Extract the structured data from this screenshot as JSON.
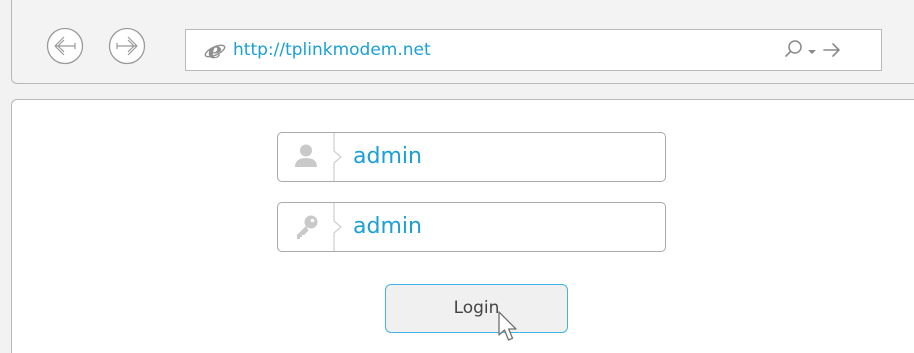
{
  "browser": {
    "back_icon": "back-arrow-icon",
    "forward_icon": "forward-arrow-icon",
    "address_bar": {
      "browser_icon": "internet-explorer-icon",
      "url": "http://tplinkmodem.net",
      "search_icon": "search-icon",
      "dropdown_icon": "dropdown-caret-icon",
      "go_icon": "go-arrow-icon"
    }
  },
  "login_form": {
    "username": {
      "icon": "user-icon",
      "value": "admin"
    },
    "password": {
      "icon": "key-icon",
      "value": "admin"
    },
    "login_label": "Login"
  },
  "colors": {
    "accent": "#1a9fd6",
    "button_border": "#42b4e6",
    "border": "#b9b9b9",
    "icon_gray": "#c9c9c9"
  }
}
